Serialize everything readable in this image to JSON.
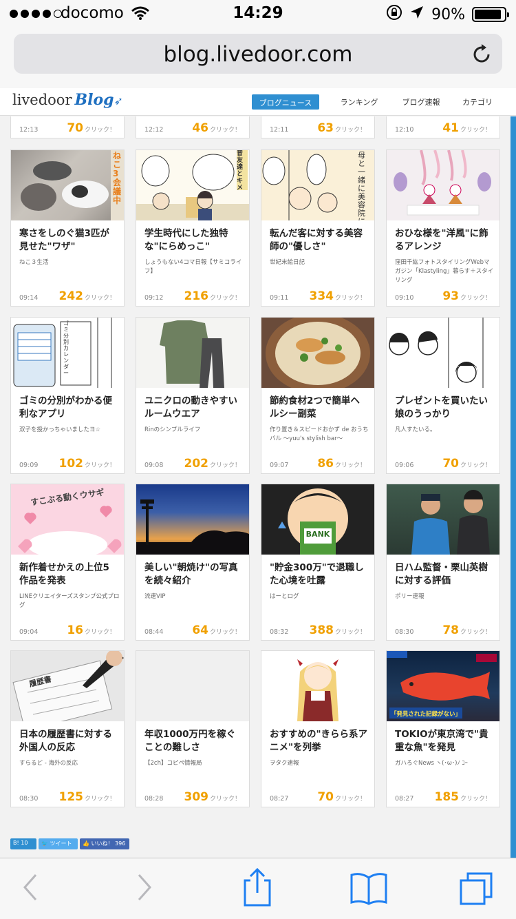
{
  "status": {
    "carrier": "docomo",
    "time": "14:29",
    "battery_percent": "90%",
    "battery_level": 0.9
  },
  "browser": {
    "url": "blog.livedoor.com"
  },
  "site": {
    "logo_text": "livedoor",
    "logo_blog": "Blog",
    "nav": [
      "ブログニュース",
      "ランキング",
      "ブログ速報",
      "カテゴリ"
    ]
  },
  "click_suffix": "クリック！",
  "top_row": [
    {
      "time": "12:13",
      "clicks": "70"
    },
    {
      "time": "12:12",
      "clicks": "46"
    },
    {
      "time": "12:11",
      "clicks": "63"
    },
    {
      "time": "12:10",
      "clicks": "41"
    }
  ],
  "rows": [
    [
      {
        "title": "寒さをしのぐ猫3匹が見せた\"ワザ\"",
        "source": "ねこ３生活",
        "time": "09:14",
        "clicks": "242",
        "thumb_text": "ねこ3会議中"
      },
      {
        "title": "学生時代にした独特な\"にらめっこ\"",
        "source": "しょうもない4コマ日報【サミコライフ】",
        "time": "09:12",
        "clicks": "216",
        "thumb_text": "昔友達とキメ顔にらめっこしようよ。"
      },
      {
        "title": "転んだ客に対する美容師の\"優しさ\"",
        "source": "世紀末絵日記",
        "time": "09:11",
        "clicks": "334",
        "thumb_text": "母と一緒に美容院に来た"
      },
      {
        "title": "おひな様を\"洋風\"に飾るアレンジ",
        "source": "窪田千紘フォトスタイリングWebマガジン「Klastyling」暮らす＋スタイリング",
        "time": "09:10",
        "clicks": "93",
        "thumb_text": ""
      }
    ],
    [
      {
        "title": "ゴミの分別がわかる便利なアプリ",
        "source": "双子を授かっちゃいましたヨ☆",
        "time": "09:09",
        "clicks": "102",
        "thumb_text": "ゴミ分別カレンダー"
      },
      {
        "title": "ユニクロの動きやすいルームウエア",
        "source": "Rinのシンプルライフ",
        "time": "09:08",
        "clicks": "202",
        "thumb_text": ""
      },
      {
        "title": "節約食材2つで簡単ヘルシー副菜",
        "source": "作り置き＆スピードおかず de おうちバル 〜yuu's stylish bar〜",
        "time": "09:07",
        "clicks": "86",
        "thumb_text": ""
      },
      {
        "title": "プレゼントを買いたい娘のうっかり",
        "source": "凡人すたいる。",
        "time": "09:06",
        "clicks": "70",
        "thumb_text": ""
      }
    ],
    [
      {
        "title": "新作着せかえの上位5作品を発表",
        "source": "LINEクリエイターズスタンプ公式ブログ",
        "time": "09:04",
        "clicks": "16",
        "thumb_text": "すこぶる動くウサギ"
      },
      {
        "title": "美しい\"朝焼け\"の写真を続々紹介",
        "source": "流速VIP",
        "time": "08:44",
        "clicks": "64",
        "thumb_text": ""
      },
      {
        "title": "\"貯金300万\"で退職した心境を吐露",
        "source": "はーとログ",
        "time": "08:32",
        "clicks": "388",
        "thumb_text": "BANK"
      },
      {
        "title": "日ハム監督・栗山英樹に対する評価",
        "source": "ポリー速報",
        "time": "08:30",
        "clicks": "78",
        "thumb_text": ""
      }
    ],
    [
      {
        "title": "日本の履歴書に対する外国人の反応",
        "source": "すらるど - 海外の反応",
        "time": "08:30",
        "clicks": "125",
        "thumb_text": "履歴書"
      },
      {
        "title": "年収1000万円を稼ぐことの難しさ",
        "source": "【2ch】コピペ情報局",
        "time": "08:28",
        "clicks": "309",
        "thumb_text": ""
      },
      {
        "title": "おすすめの\"きらら系アニメ\"を列挙",
        "source": "ヲタク速報",
        "time": "08:27",
        "clicks": "70",
        "thumb_text": ""
      },
      {
        "title": "TOKIOが東京湾で\"貴重な魚\"を発見",
        "source": "ガハろぐNews ヽ(･ω･)ﾉ ｺｰ",
        "time": "08:27",
        "clicks": "185",
        "thumb_text": "「発見された記録がない」"
      }
    ]
  ],
  "share": {
    "hatena": "B! 10",
    "tweet": "ツイート",
    "like": "いいね！ 396"
  }
}
